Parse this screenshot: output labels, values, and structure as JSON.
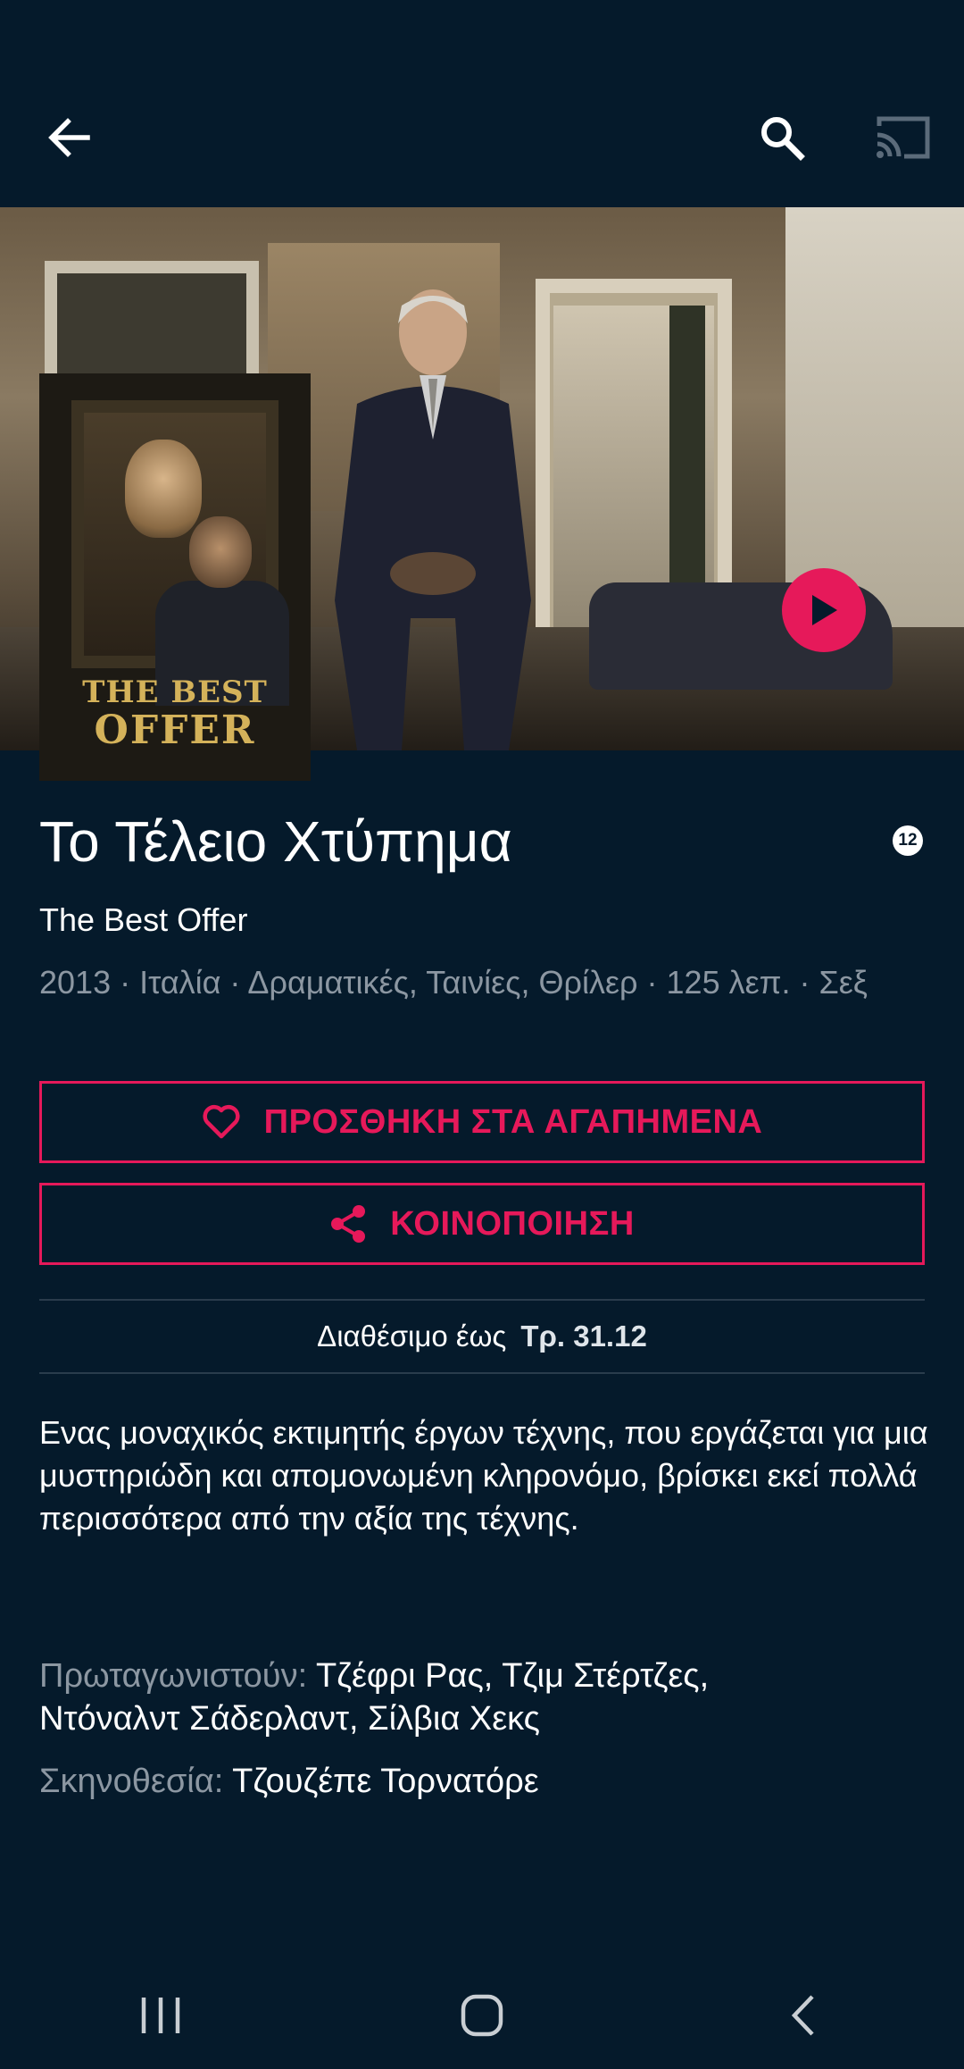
{
  "toolbar": {
    "back_icon": "arrow-left-icon",
    "search_icon": "search-icon",
    "cast_icon": "cast-icon"
  },
  "hero": {
    "play_icon": "play-icon",
    "accent_color": "#e6195a"
  },
  "poster": {
    "line1": "THE BEST",
    "line2": "OFFER"
  },
  "movie": {
    "title": "Το Τέλειο Χτύπημα",
    "age_rating": "12",
    "original_title": "The Best Offer",
    "meta": "2013 · Ιταλία · Δραματικές, Ταινίες, Θρίλερ · 125 λεπ. · Σεξ"
  },
  "actions": {
    "favorite_label": "ΠΡΟΣΘΗΚΗ ΣΤΑ ΑΓΑΠΗΜΕΝΑ",
    "favorite_icon": "heart-icon",
    "share_label": "ΚΟΙΝΟΠΟΙΗΣΗ",
    "share_icon": "share-icon"
  },
  "availability": {
    "label": "Διαθέσιμο έως",
    "date": "Τρ. 31.12"
  },
  "description": "Ενας μοναχικός εκτιμητής έργων τέχνης, που εργάζεται για μια μυστηριώδη και απομονωμένη κληρονόμο, βρίσκει εκεί πολλά περισσότερα από την αξία της τέχνης.",
  "credits": {
    "cast_label": "Πρωταγωνιστούν:",
    "cast_line1": "Τζέφρι  Ρας, Τζιμ  Στέρτζες,",
    "cast_line2": "Ντόναλντ  Σάδερλαντ, Σίλβια Χεκς",
    "director_label": "Σκηνοθεσία:",
    "director": "Τζουζέπε Τορνατόρε"
  },
  "system_nav": {
    "recents_icon": "recents-icon",
    "home_icon": "home-icon",
    "back_icon": "back-chevron-icon"
  }
}
